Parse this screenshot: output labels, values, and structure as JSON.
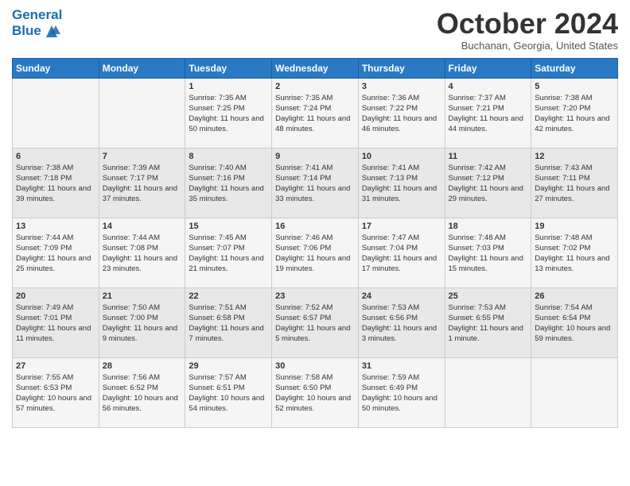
{
  "header": {
    "logo_general": "General",
    "logo_blue": "Blue",
    "title": "October 2024",
    "location": "Buchanan, Georgia, United States"
  },
  "days_of_week": [
    "Sunday",
    "Monday",
    "Tuesday",
    "Wednesday",
    "Thursday",
    "Friday",
    "Saturday"
  ],
  "weeks": [
    [
      {
        "day": "",
        "sunrise": "",
        "sunset": "",
        "daylight": ""
      },
      {
        "day": "",
        "sunrise": "",
        "sunset": "",
        "daylight": ""
      },
      {
        "day": "1",
        "sunrise": "Sunrise: 7:35 AM",
        "sunset": "Sunset: 7:25 PM",
        "daylight": "Daylight: 11 hours and 50 minutes."
      },
      {
        "day": "2",
        "sunrise": "Sunrise: 7:35 AM",
        "sunset": "Sunset: 7:24 PM",
        "daylight": "Daylight: 11 hours and 48 minutes."
      },
      {
        "day": "3",
        "sunrise": "Sunrise: 7:36 AM",
        "sunset": "Sunset: 7:22 PM",
        "daylight": "Daylight: 11 hours and 46 minutes."
      },
      {
        "day": "4",
        "sunrise": "Sunrise: 7:37 AM",
        "sunset": "Sunset: 7:21 PM",
        "daylight": "Daylight: 11 hours and 44 minutes."
      },
      {
        "day": "5",
        "sunrise": "Sunrise: 7:38 AM",
        "sunset": "Sunset: 7:20 PM",
        "daylight": "Daylight: 11 hours and 42 minutes."
      }
    ],
    [
      {
        "day": "6",
        "sunrise": "Sunrise: 7:38 AM",
        "sunset": "Sunset: 7:18 PM",
        "daylight": "Daylight: 11 hours and 39 minutes."
      },
      {
        "day": "7",
        "sunrise": "Sunrise: 7:39 AM",
        "sunset": "Sunset: 7:17 PM",
        "daylight": "Daylight: 11 hours and 37 minutes."
      },
      {
        "day": "8",
        "sunrise": "Sunrise: 7:40 AM",
        "sunset": "Sunset: 7:16 PM",
        "daylight": "Daylight: 11 hours and 35 minutes."
      },
      {
        "day": "9",
        "sunrise": "Sunrise: 7:41 AM",
        "sunset": "Sunset: 7:14 PM",
        "daylight": "Daylight: 11 hours and 33 minutes."
      },
      {
        "day": "10",
        "sunrise": "Sunrise: 7:41 AM",
        "sunset": "Sunset: 7:13 PM",
        "daylight": "Daylight: 11 hours and 31 minutes."
      },
      {
        "day": "11",
        "sunrise": "Sunrise: 7:42 AM",
        "sunset": "Sunset: 7:12 PM",
        "daylight": "Daylight: 11 hours and 29 minutes."
      },
      {
        "day": "12",
        "sunrise": "Sunrise: 7:43 AM",
        "sunset": "Sunset: 7:11 PM",
        "daylight": "Daylight: 11 hours and 27 minutes."
      }
    ],
    [
      {
        "day": "13",
        "sunrise": "Sunrise: 7:44 AM",
        "sunset": "Sunset: 7:09 PM",
        "daylight": "Daylight: 11 hours and 25 minutes."
      },
      {
        "day": "14",
        "sunrise": "Sunrise: 7:44 AM",
        "sunset": "Sunset: 7:08 PM",
        "daylight": "Daylight: 11 hours and 23 minutes."
      },
      {
        "day": "15",
        "sunrise": "Sunrise: 7:45 AM",
        "sunset": "Sunset: 7:07 PM",
        "daylight": "Daylight: 11 hours and 21 minutes."
      },
      {
        "day": "16",
        "sunrise": "Sunrise: 7:46 AM",
        "sunset": "Sunset: 7:06 PM",
        "daylight": "Daylight: 11 hours and 19 minutes."
      },
      {
        "day": "17",
        "sunrise": "Sunrise: 7:47 AM",
        "sunset": "Sunset: 7:04 PM",
        "daylight": "Daylight: 11 hours and 17 minutes."
      },
      {
        "day": "18",
        "sunrise": "Sunrise: 7:48 AM",
        "sunset": "Sunset: 7:03 PM",
        "daylight": "Daylight: 11 hours and 15 minutes."
      },
      {
        "day": "19",
        "sunrise": "Sunrise: 7:48 AM",
        "sunset": "Sunset: 7:02 PM",
        "daylight": "Daylight: 11 hours and 13 minutes."
      }
    ],
    [
      {
        "day": "20",
        "sunrise": "Sunrise: 7:49 AM",
        "sunset": "Sunset: 7:01 PM",
        "daylight": "Daylight: 11 hours and 11 minutes."
      },
      {
        "day": "21",
        "sunrise": "Sunrise: 7:50 AM",
        "sunset": "Sunset: 7:00 PM",
        "daylight": "Daylight: 11 hours and 9 minutes."
      },
      {
        "day": "22",
        "sunrise": "Sunrise: 7:51 AM",
        "sunset": "Sunset: 6:58 PM",
        "daylight": "Daylight: 11 hours and 7 minutes."
      },
      {
        "day": "23",
        "sunrise": "Sunrise: 7:52 AM",
        "sunset": "Sunset: 6:57 PM",
        "daylight": "Daylight: 11 hours and 5 minutes."
      },
      {
        "day": "24",
        "sunrise": "Sunrise: 7:53 AM",
        "sunset": "Sunset: 6:56 PM",
        "daylight": "Daylight: 11 hours and 3 minutes."
      },
      {
        "day": "25",
        "sunrise": "Sunrise: 7:53 AM",
        "sunset": "Sunset: 6:55 PM",
        "daylight": "Daylight: 11 hours and 1 minute."
      },
      {
        "day": "26",
        "sunrise": "Sunrise: 7:54 AM",
        "sunset": "Sunset: 6:54 PM",
        "daylight": "Daylight: 10 hours and 59 minutes."
      }
    ],
    [
      {
        "day": "27",
        "sunrise": "Sunrise: 7:55 AM",
        "sunset": "Sunset: 6:53 PM",
        "daylight": "Daylight: 10 hours and 57 minutes."
      },
      {
        "day": "28",
        "sunrise": "Sunrise: 7:56 AM",
        "sunset": "Sunset: 6:52 PM",
        "daylight": "Daylight: 10 hours and 56 minutes."
      },
      {
        "day": "29",
        "sunrise": "Sunrise: 7:57 AM",
        "sunset": "Sunset: 6:51 PM",
        "daylight": "Daylight: 10 hours and 54 minutes."
      },
      {
        "day": "30",
        "sunrise": "Sunrise: 7:58 AM",
        "sunset": "Sunset: 6:50 PM",
        "daylight": "Daylight: 10 hours and 52 minutes."
      },
      {
        "day": "31",
        "sunrise": "Sunrise: 7:59 AM",
        "sunset": "Sunset: 6:49 PM",
        "daylight": "Daylight: 10 hours and 50 minutes."
      },
      {
        "day": "",
        "sunrise": "",
        "sunset": "",
        "daylight": ""
      },
      {
        "day": "",
        "sunrise": "",
        "sunset": "",
        "daylight": ""
      }
    ]
  ]
}
